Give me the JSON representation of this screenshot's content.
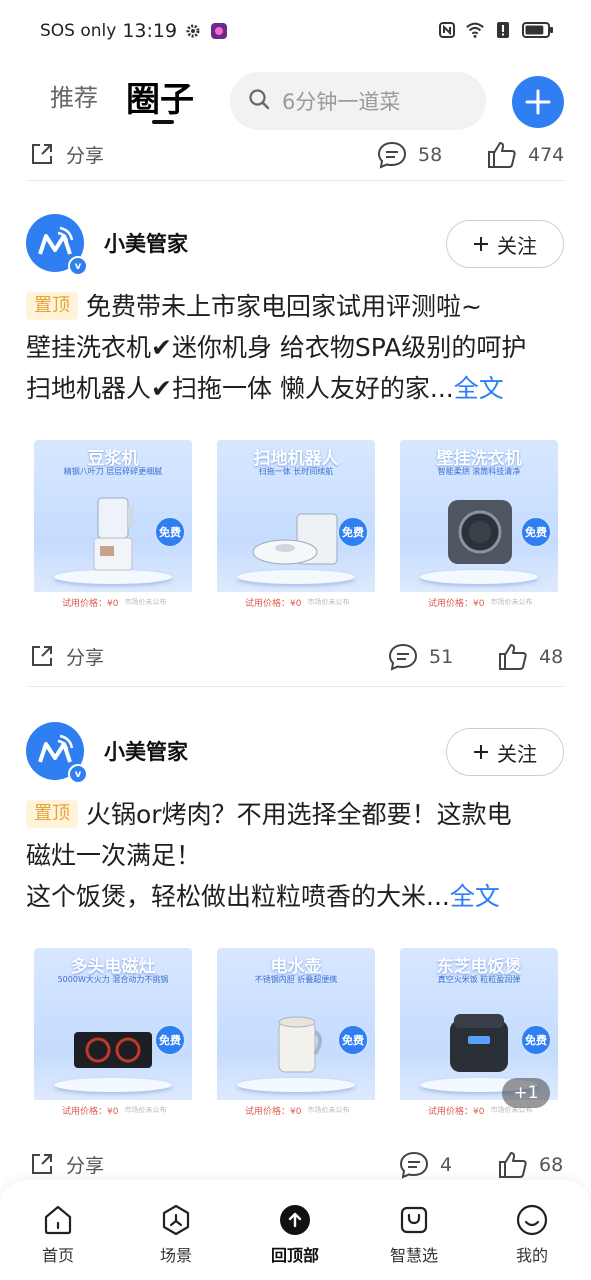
{
  "status_bar": {
    "carrier": "SOS only",
    "time": "13:19",
    "battery_level": 0.85
  },
  "header": {
    "tabs": [
      {
        "label": "推荐",
        "active": false
      },
      {
        "label": "圈子",
        "active": true
      }
    ],
    "search_placeholder": "6分钟一道菜"
  },
  "feed": {
    "top_actions": {
      "share": "分享",
      "comments": "58",
      "likes": "474"
    },
    "posts": [
      {
        "author": "小美管家",
        "follow_label": "关注",
        "pin_label": "置顶",
        "lines": [
          "免费带未上市家电回家试用评测啦~",
          "壁挂洗衣机✔迷你机身 给衣物SPA级别的呵护",
          "扫地机器人✔扫拖一体 懒人友好的家..."
        ],
        "more_label": "全文",
        "images": [
          {
            "title": "豆浆机",
            "subtitle": "精钢八叶刀 层层碎碎更细腻",
            "free": "免费",
            "price": "试用价格：¥0",
            "note": "市场价未公布"
          },
          {
            "title": "扫地机器人",
            "subtitle": "扫拖一体  长时间续航",
            "free": "免费",
            "price": "试用价格：¥0",
            "note": "市场价未公布"
          },
          {
            "title": "壁挂洗衣机",
            "subtitle": "智能柔烘  滚筒科技清净",
            "free": "免费",
            "price": "试用价格：¥0",
            "note": "市场价未公布"
          }
        ],
        "actions": {
          "share": "分享",
          "comments": "51",
          "likes": "48"
        }
      },
      {
        "author": "小美管家",
        "follow_label": "关注",
        "pin_label": "置顶",
        "lines": [
          "火锅or烤肉？不用选择全都要！这款电",
          "磁灶一次满足！",
          "这个饭煲，轻松做出粒粒喷香的大米..."
        ],
        "more_label": "全文",
        "images": [
          {
            "title": "多头电磁灶",
            "subtitle": "5000W大火力  混合动力不挑锅",
            "free": "免费",
            "price": "试用价格：¥0",
            "note": "市场价未公布"
          },
          {
            "title": "电水壶",
            "subtitle": "不锈钢内胆  折叠超便携",
            "free": "免费",
            "price": "试用价格：¥0",
            "note": "市场价未公布"
          },
          {
            "title": "东芝电饭煲",
            "subtitle": "真空火米饭  粒粒盈润弹",
            "free": "免费",
            "price": "试用价格：¥0",
            "note": "市场价未公布"
          }
        ],
        "extra_images_badge": "+1",
        "actions": {
          "share": "分享",
          "comments": "4",
          "likes": "68"
        }
      }
    ]
  },
  "bottom_nav": [
    {
      "label": "首页",
      "icon": "home-icon"
    },
    {
      "label": "场景",
      "icon": "scene-icon"
    },
    {
      "label": "回顶部",
      "icon": "back-to-top-icon",
      "active": true
    },
    {
      "label": "智慧选",
      "icon": "shopping-bag-icon"
    },
    {
      "label": "我的",
      "icon": "profile-icon"
    }
  ],
  "colors": {
    "accent": "#2f7ff3",
    "pin_bg": "#fff4da",
    "pin_text": "#e9a23b"
  }
}
